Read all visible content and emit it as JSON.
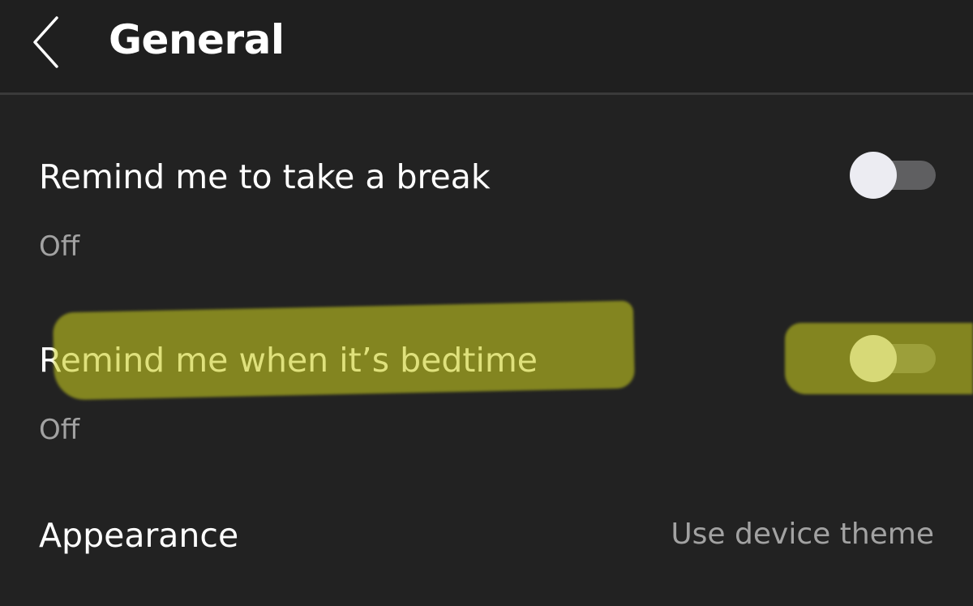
{
  "header": {
    "title": "General",
    "back_icon": "chevron-left-icon"
  },
  "settings": [
    {
      "label": "Remind me to take a break",
      "status": "Off",
      "toggle_on": false
    },
    {
      "label": "Remind me when it’s bedtime",
      "status": "Off",
      "toggle_on": false,
      "highlighted": true,
      "highlight_color": "#c9cd1f"
    }
  ],
  "appearance": {
    "label": "Appearance",
    "value": "Use device theme"
  },
  "colors": {
    "background": "#222222",
    "text": "#ffffff",
    "secondary_text": "#a2a2a2",
    "toggle_track": "#5f5f61",
    "toggle_knob": "#ececf2"
  }
}
